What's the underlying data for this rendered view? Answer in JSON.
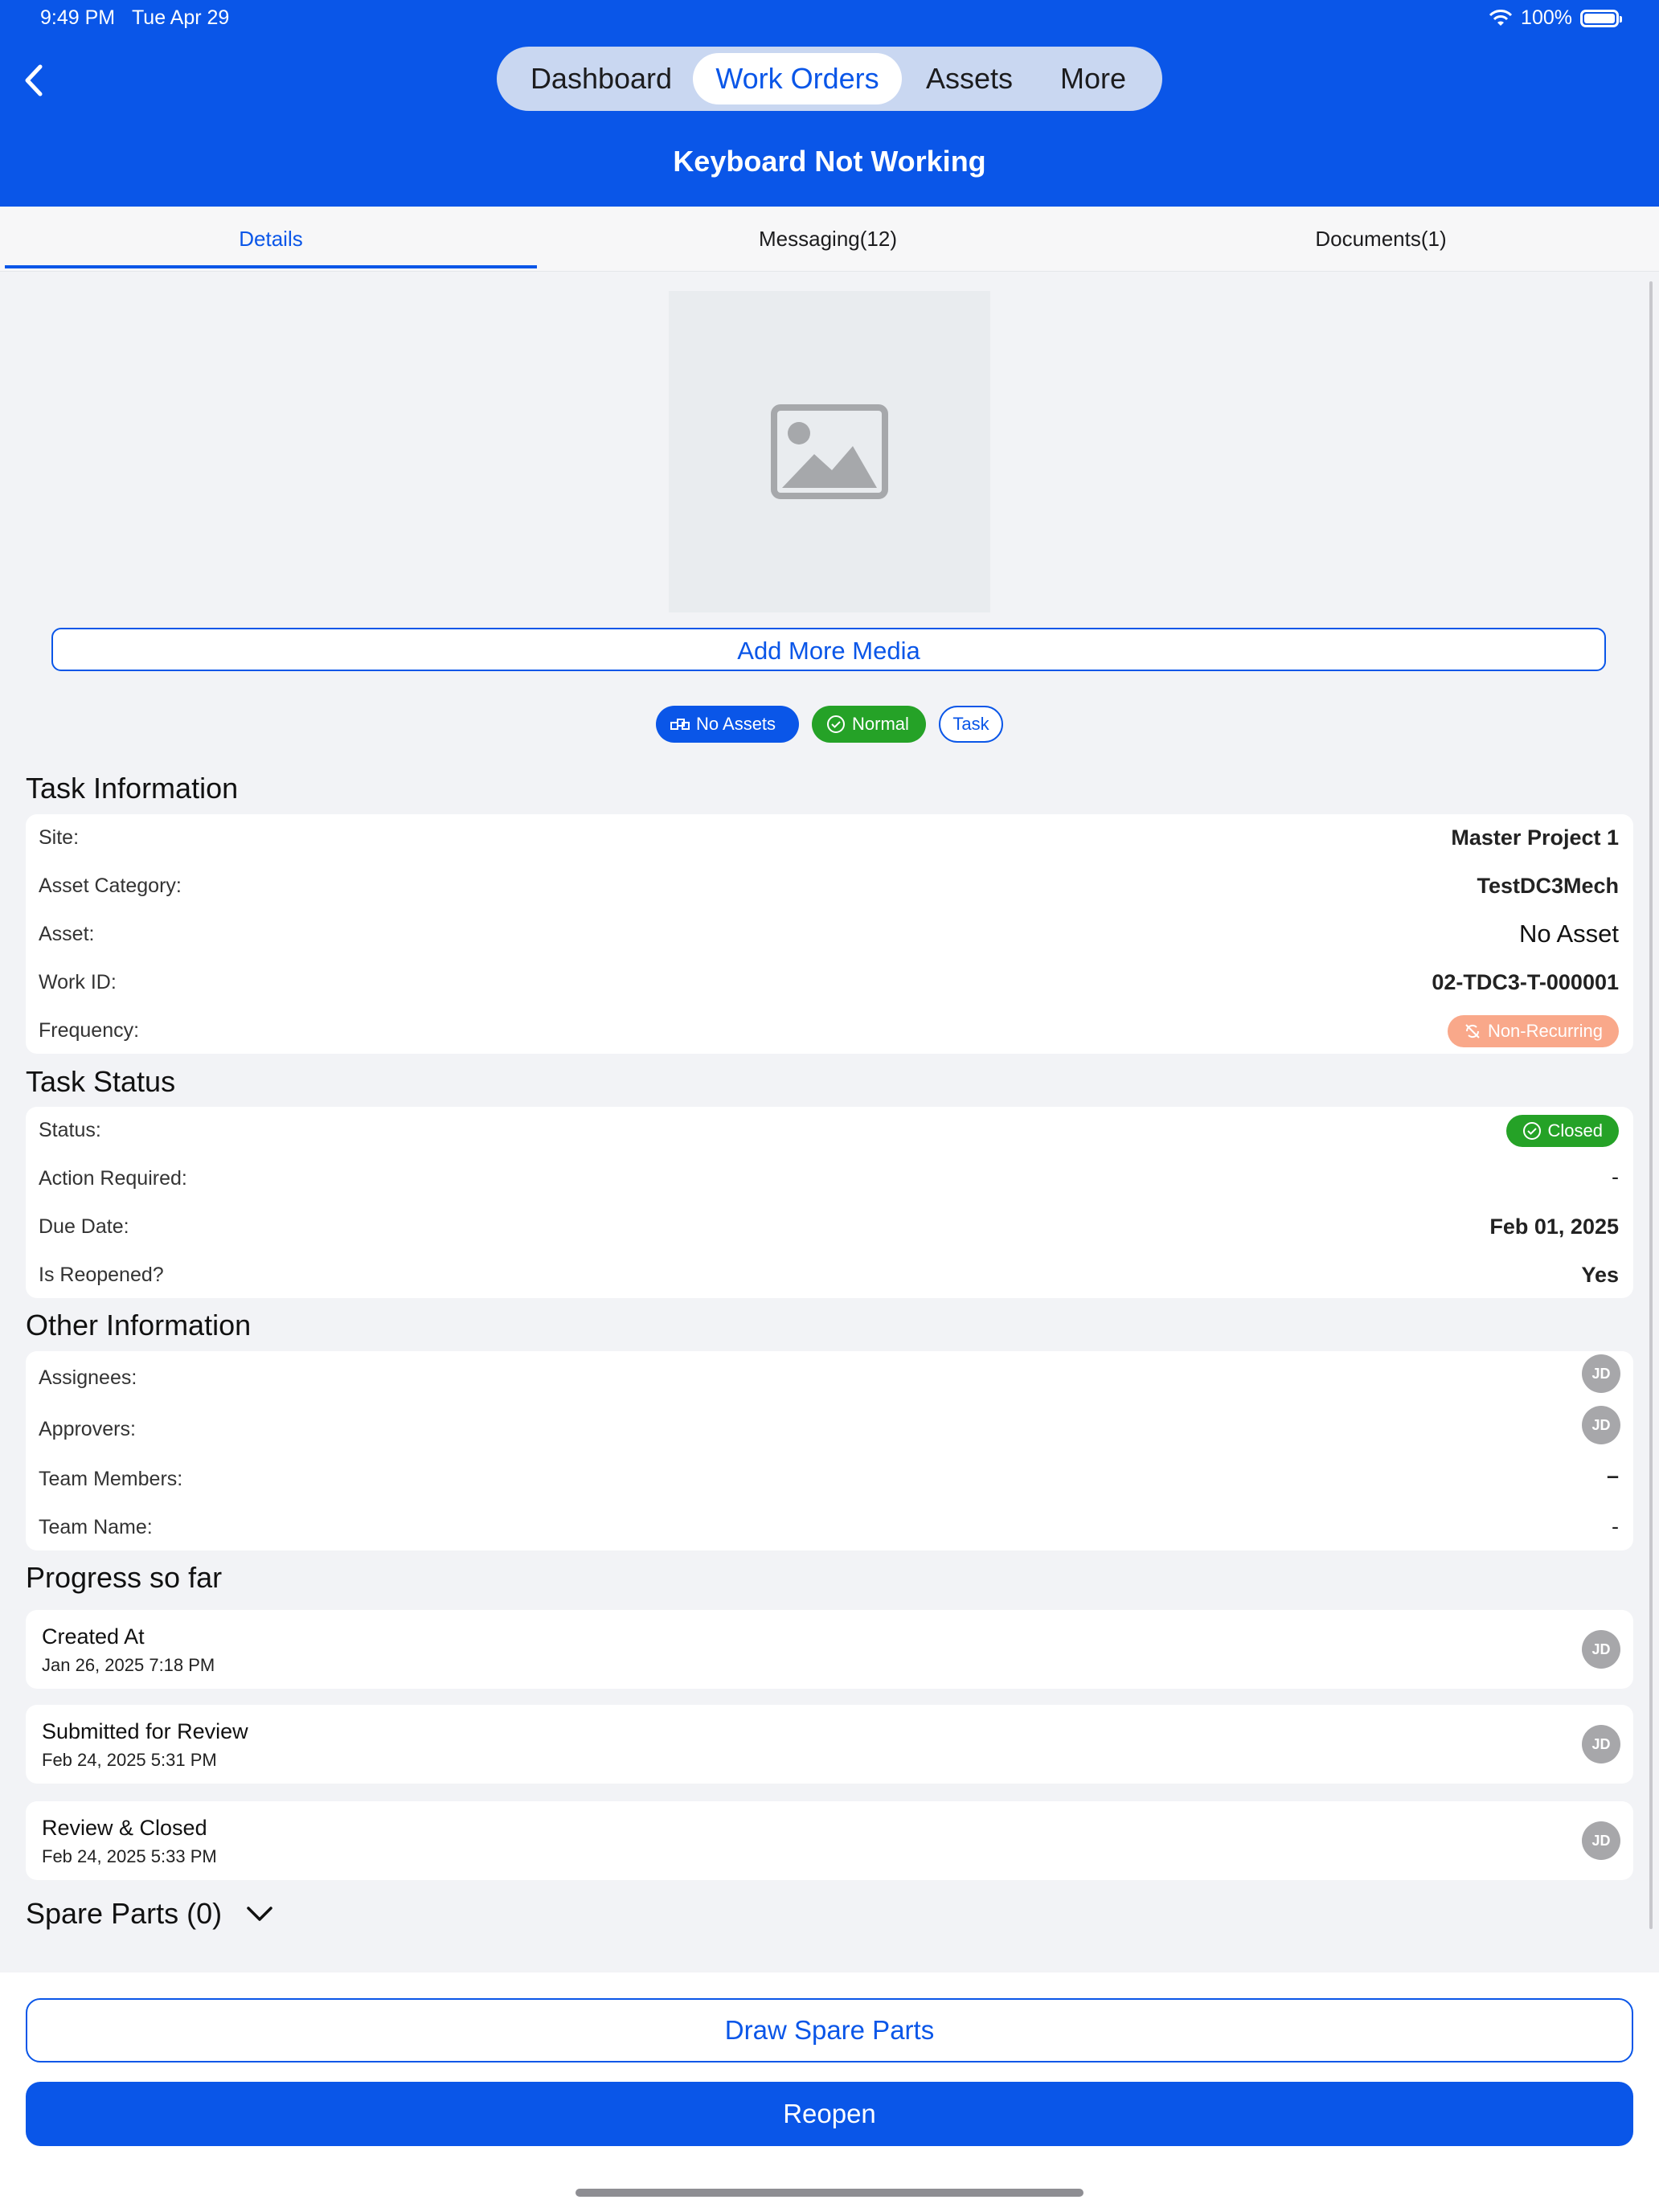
{
  "status_bar": {
    "time": "9:49 PM",
    "date": "Tue Apr 29",
    "battery": "100%"
  },
  "nav": {
    "segments": [
      "Dashboard",
      "Work Orders",
      "Assets",
      "More"
    ],
    "active_segment": "Work Orders",
    "page_title": "Keyboard Not Working"
  },
  "tabs": {
    "details": "Details",
    "messaging": "Messaging(12)",
    "documents": "Documents(1)",
    "active": "Details"
  },
  "media": {
    "add_button": "Add More Media"
  },
  "chips": {
    "assets": "No Assets",
    "priority": "Normal",
    "type": "Task"
  },
  "task_info": {
    "title": "Task Information",
    "site_label": "Site:",
    "site": "Master Project 1",
    "asset_category_label": "Asset Category:",
    "asset_category": "TestDC3Mech",
    "asset_label": "Asset:",
    "asset": "No Asset",
    "work_id_label": "Work ID:",
    "work_id": "02-TDC3-T-000001",
    "frequency_label": "Frequency:",
    "frequency": "Non-Recurring"
  },
  "task_status": {
    "title": "Task Status",
    "status_label": "Status:",
    "status": "Closed",
    "action_label": "Action Required:",
    "action": "-",
    "due_label": "Due Date:",
    "due": "Feb 01, 2025",
    "reopened_label": "Is Reopened?",
    "reopened": "Yes"
  },
  "other_info": {
    "title": "Other Information",
    "assignees_label": "Assignees:",
    "assignees_avatar": "JD",
    "approvers_label": "Approvers:",
    "approvers_avatar": "JD",
    "team_members_label": "Team Members:",
    "team_members": "–",
    "team_name_label": "Team Name:",
    "team_name": "-"
  },
  "progress": {
    "title": "Progress so far",
    "items": [
      {
        "title": "Created At",
        "date": "Jan 26, 2025 7:18 PM",
        "avatar": "JD"
      },
      {
        "title": "Submitted for Review",
        "date": "Feb 24, 2025 5:31 PM",
        "avatar": "JD"
      },
      {
        "title": "Review & Closed",
        "date": "Feb 24, 2025 5:33 PM",
        "avatar": "JD"
      }
    ]
  },
  "spare_parts": {
    "title": "Spare Parts (0)"
  },
  "actions": {
    "draw": "Draw Spare Parts",
    "reopen": "Reopen"
  },
  "colors": {
    "primary": "#0a56e8",
    "success": "#25a227",
    "warning_soft": "#f9a88a",
    "background": "#f2f3f6"
  }
}
